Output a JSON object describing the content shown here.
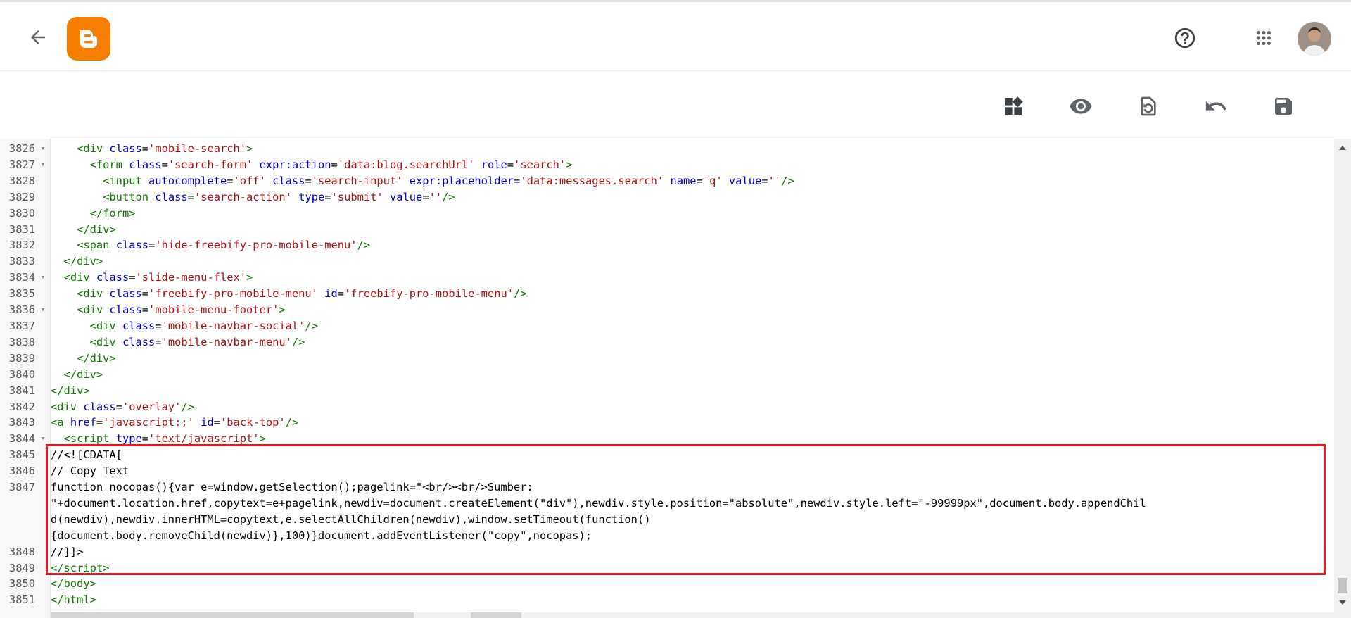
{
  "header": {
    "icons": {
      "back": "arrow-back-icon",
      "logo": "blogger-logo-icon",
      "help": "help-circle-icon",
      "apps": "apps-grid-icon",
      "avatar": "user-avatar"
    },
    "colors": {
      "logo_bg": "#f57d00",
      "highlight_border": "#e41922"
    }
  },
  "toolbar": {
    "icons": [
      "layout-widgets-icon",
      "preview-eye-icon",
      "restore-page-icon",
      "undo-icon",
      "save-icon"
    ]
  },
  "editor": {
    "lines": [
      {
        "num": "3826",
        "fold": "▾",
        "indent": "    ",
        "html": "<span class='tg'>&lt;div </span><span class='at'>class</span>=<span class='vl'>'mobile-search'</span><span class='tg'>&gt;</span>"
      },
      {
        "num": "3827",
        "fold": "▾",
        "indent": "      ",
        "html": "<span class='tg'>&lt;form </span><span class='at'>class</span>=<span class='vl'>'search-form'</span> <span class='at'>expr:action</span>=<span class='vl'>'data:blog.searchUrl'</span> <span class='at'>role</span>=<span class='vl'>'search'</span><span class='tg'>&gt;</span>"
      },
      {
        "num": "3828",
        "fold": "",
        "indent": "        ",
        "html": "<span class='tg'>&lt;input </span><span class='at'>autocomplete</span>=<span class='vl'>'off'</span> <span class='at'>class</span>=<span class='vl'>'search-input'</span> <span class='at'>expr:placeholder</span>=<span class='vl'>'data:messages.search'</span> <span class='at'>name</span>=<span class='vl'>'q'</span> <span class='at'>value</span>=<span class='vl'>''</span><span class='tg'>/&gt;</span>"
      },
      {
        "num": "3829",
        "fold": "",
        "indent": "        ",
        "html": "<span class='tg'>&lt;button </span><span class='at'>class</span>=<span class='vl'>'search-action'</span> <span class='at'>type</span>=<span class='vl'>'submit'</span> <span class='at'>value</span>=<span class='vl'>''</span><span class='tg'>/&gt;</span>"
      },
      {
        "num": "3830",
        "fold": "",
        "indent": "      ",
        "html": "<span class='tg'>&lt;/form&gt;</span>"
      },
      {
        "num": "3831",
        "fold": "",
        "indent": "    ",
        "html": "<span class='tg'>&lt;/div&gt;</span>"
      },
      {
        "num": "3832",
        "fold": "",
        "indent": "    ",
        "html": "<span class='tg'>&lt;span </span><span class='at'>class</span>=<span class='vl'>'hide-freebify-pro-mobile-menu'</span><span class='tg'>/&gt;</span>"
      },
      {
        "num": "3833",
        "fold": "",
        "indent": "  ",
        "html": "<span class='tg'>&lt;/div&gt;</span>"
      },
      {
        "num": "3834",
        "fold": "▾",
        "indent": "  ",
        "html": "<span class='tg'>&lt;div </span><span class='at'>class</span>=<span class='vl'>'slide-menu-flex'</span><span class='tg'>&gt;</span>"
      },
      {
        "num": "3835",
        "fold": "",
        "indent": "    ",
        "html": "<span class='tg'>&lt;div </span><span class='at'>class</span>=<span class='vl'>'freebify-pro-mobile-menu'</span> <span class='at'>id</span>=<span class='vl'>'freebify-pro-mobile-menu'</span><span class='tg'>/&gt;</span>"
      },
      {
        "num": "3836",
        "fold": "▾",
        "indent": "    ",
        "html": "<span class='tg'>&lt;div </span><span class='at'>class</span>=<span class='vl'>'mobile-menu-footer'</span><span class='tg'>&gt;</span>"
      },
      {
        "num": "3837",
        "fold": "",
        "indent": "      ",
        "html": "<span class='tg'>&lt;div </span><span class='at'>class</span>=<span class='vl'>'mobile-navbar-social'</span><span class='tg'>/&gt;</span>"
      },
      {
        "num": "3838",
        "fold": "",
        "indent": "      ",
        "html": "<span class='tg'>&lt;div </span><span class='at'>class</span>=<span class='vl'>'mobile-navbar-menu'</span><span class='tg'>/&gt;</span>"
      },
      {
        "num": "3839",
        "fold": "",
        "indent": "    ",
        "html": "<span class='tg'>&lt;/div&gt;</span>"
      },
      {
        "num": "3840",
        "fold": "",
        "indent": "  ",
        "html": "<span class='tg'>&lt;/div&gt;</span>"
      },
      {
        "num": "3841",
        "fold": "",
        "indent": "",
        "html": "<span class='tg'>&lt;/div&gt;</span>"
      },
      {
        "num": "3842",
        "fold": "",
        "indent": "",
        "html": "<span class='tg'>&lt;div </span><span class='at'>class</span>=<span class='vl'>'overlay'</span><span class='tg'>/&gt;</span>"
      },
      {
        "num": "3843",
        "fold": "",
        "indent": "",
        "html": "<span class='tg'>&lt;a </span><span class='at'>href</span>=<span class='vl'>'javascript:;'</span> <span class='at'>id</span>=<span class='vl'>'back-top'</span><span class='tg'>/&gt;</span>"
      },
      {
        "num": "3844",
        "fold": "▾",
        "indent": "  ",
        "html": "<span class='tg'>&lt;script </span><span class='at'>type</span>=<span class='vl'>'text/javascript'</span><span class='tg'>&gt;</span>"
      },
      {
        "num": "3845",
        "fold": "",
        "indent": "",
        "html": "//&lt;![CDATA["
      },
      {
        "num": "3846",
        "fold": "",
        "indent": "",
        "html": "// Copy Text"
      },
      {
        "num": "3847",
        "fold": "",
        "indent": "",
        "html": "function nocopas(){var e=window.getSelection();pagelink=\"&lt;br/&gt;&lt;br/&gt;Sumber:"
      },
      {
        "num": "",
        "fold": "",
        "indent": "",
        "html": "\"+document.location.href,copytext=e+pagelink,newdiv=document.createElement(\"div\"),newdiv.style.position=\"absolute\",newdiv.style.left=\"-99999px\",document.body.appendChil"
      },
      {
        "num": "",
        "fold": "",
        "indent": "",
        "html": "d(newdiv),newdiv.innerHTML=copytext,e.selectAllChildren(newdiv),window.setTimeout(function()"
      },
      {
        "num": "",
        "fold": "",
        "indent": "",
        "html": "{document.body.removeChild(newdiv)},100)}document.addEventListener(\"copy\",nocopas);"
      },
      {
        "num": "3848",
        "fold": "",
        "indent": "",
        "html": "//]]&gt;"
      },
      {
        "num": "3849",
        "fold": "",
        "indent": "",
        "html": "<span class='tg'>&lt;/script&gt;</span>"
      },
      {
        "num": "3850",
        "fold": "",
        "indent": "",
        "html": "<span class='tg'>&lt;/body&gt;</span>"
      },
      {
        "num": "3851",
        "fold": "",
        "indent": "",
        "html": "<span class='tg'>&lt;/html&gt;</span>"
      }
    ]
  }
}
